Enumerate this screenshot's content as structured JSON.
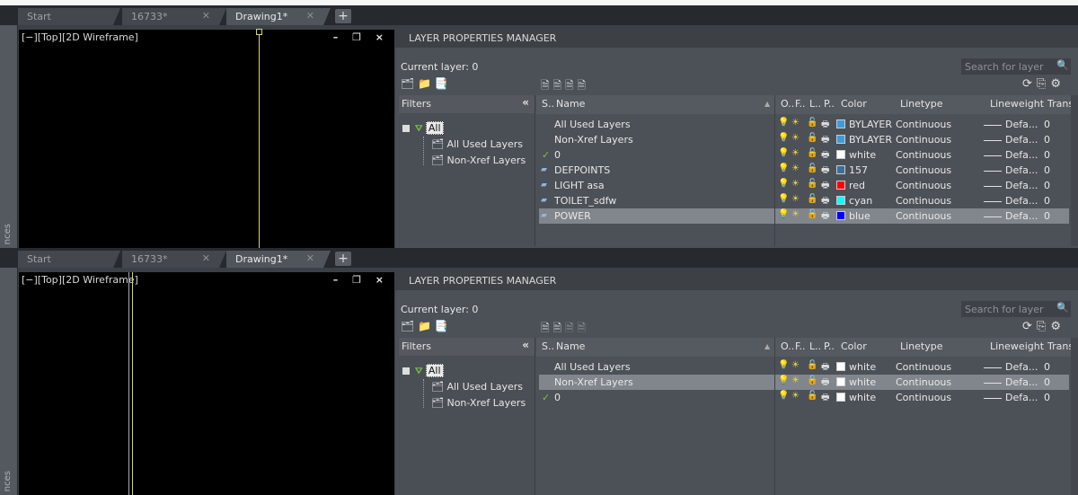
{
  "tabs": [
    "Start",
    "16733*",
    "Drawing1*"
  ],
  "plus": "+",
  "side_text": "nces",
  "viewport_label": "[−][Top][2D Wireframe]",
  "viewport_controls": "– ❐ ×",
  "lpm": {
    "title": "LAYER PROPERTIES MANAGER",
    "current_layer": "Current layer: 0",
    "search_placeholder": "Search for layer",
    "filters_header": "Filters",
    "tree": {
      "all": "All",
      "used": "All Used Layers",
      "nonxref": "Non-Xref Layers"
    },
    "columns": [
      "S..",
      "Name",
      "O..",
      "F..",
      "L..",
      "P..",
      "Color",
      "Linetype",
      "Lineweight",
      "Trans"
    ]
  },
  "panel1": {
    "rows": [
      {
        "status": "",
        "name": "All Used Layers",
        "color": "BYLAYER",
        "hex": "#3d9bd9",
        "linetype": "Continuous",
        "lineweight": "Defa...",
        "trans": "0",
        "kind": "filter"
      },
      {
        "status": "",
        "name": "Non-Xref Layers",
        "color": "BYLAYER",
        "hex": "#3d9bd9",
        "linetype": "Continuous",
        "lineweight": "Defa...",
        "trans": "0",
        "kind": "filter"
      },
      {
        "status": "current",
        "name": "0",
        "color": "white",
        "hex": "#ffffff",
        "linetype": "Continuous",
        "lineweight": "Defa...",
        "trans": "0",
        "kind": "layer"
      },
      {
        "status": "layer",
        "name": "DEFPOINTS",
        "color": "157",
        "hex": "#3b6f98",
        "linetype": "Continuous",
        "lineweight": "Defa...",
        "trans": "0",
        "kind": "layer"
      },
      {
        "status": "layer",
        "name": "LIGHT asa",
        "color": "red",
        "hex": "#ff0000",
        "linetype": "Continuous",
        "lineweight": "Defa...",
        "trans": "0",
        "kind": "layer"
      },
      {
        "status": "layer",
        "name": "TOILET_sdfw",
        "color": "cyan",
        "hex": "#00ffff",
        "linetype": "Continuous",
        "lineweight": "Defa...",
        "trans": "0",
        "kind": "layer"
      },
      {
        "status": "layer",
        "name": "POWER",
        "color": "blue",
        "hex": "#0000ff",
        "linetype": "Continuous",
        "lineweight": "Defa...",
        "trans": "0",
        "kind": "layer",
        "selected": true
      }
    ]
  },
  "panel2": {
    "rows": [
      {
        "status": "",
        "name": "All Used Layers",
        "color": "white",
        "hex": "#ffffff",
        "linetype": "Continuous",
        "lineweight": "Defa...",
        "trans": "0",
        "kind": "filter"
      },
      {
        "status": "",
        "name": "Non-Xref Layers",
        "color": "white",
        "hex": "#ffffff",
        "linetype": "Continuous",
        "lineweight": "Defa...",
        "trans": "0",
        "kind": "filter",
        "selected": true
      },
      {
        "status": "current",
        "name": "0",
        "color": "white",
        "hex": "#ffffff",
        "linetype": "Continuous",
        "lineweight": "Defa...",
        "trans": "0",
        "kind": "layer"
      }
    ]
  },
  "colors": {
    "accent_yellow": "#d6d672",
    "selection": "#81868c",
    "check_green": "#7bc142"
  }
}
